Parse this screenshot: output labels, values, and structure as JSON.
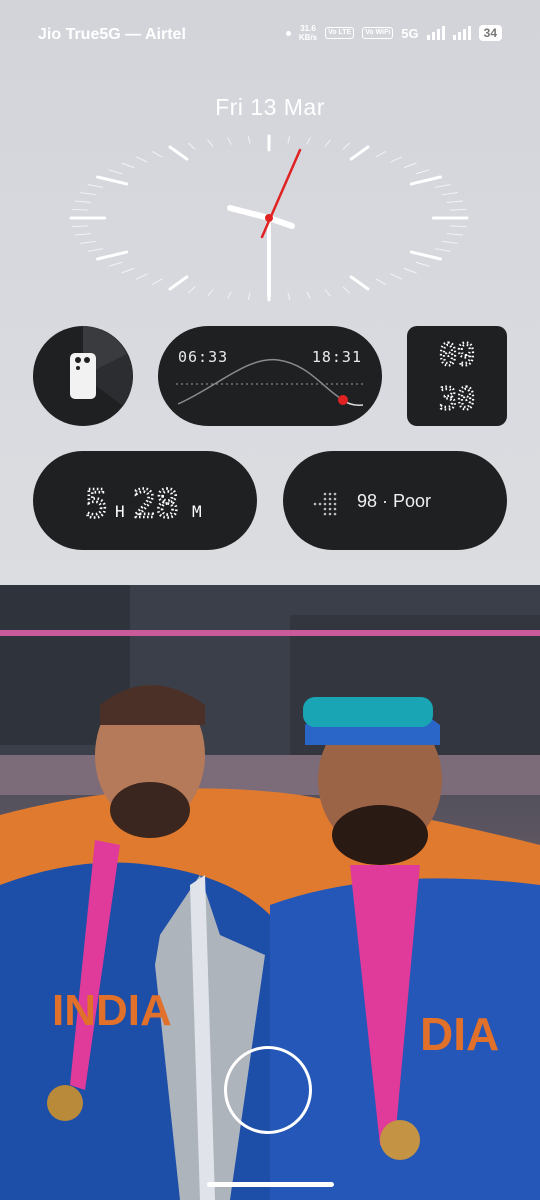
{
  "status_bar": {
    "carrier": "Jio True5G — Airtel",
    "net_speed_value": "31.6",
    "net_speed_unit": "KB/s",
    "volte1": "Vo LTE",
    "volte2": "Vo WiFi",
    "network": "5G",
    "battery": "34"
  },
  "lockscreen": {
    "date": "Fri 13 Mar"
  },
  "widgets": {
    "sun": {
      "sunrise": "06:33",
      "sunset": "18:31"
    },
    "clock_digits": {
      "hour": "09",
      "minute": "30"
    },
    "sleep": {
      "hours": "5",
      "hours_unit": "H",
      "minutes": "28",
      "minutes_unit": "M"
    },
    "air_quality": {
      "text": "98 · Poor"
    }
  },
  "colors": {
    "widget_bg": "#1f2022",
    "accent_red": "#e02222"
  },
  "icons": {
    "phone": "phone-back-icon",
    "camera": "camera-shortcut-icon",
    "air": "air-quality-dots-icon"
  }
}
